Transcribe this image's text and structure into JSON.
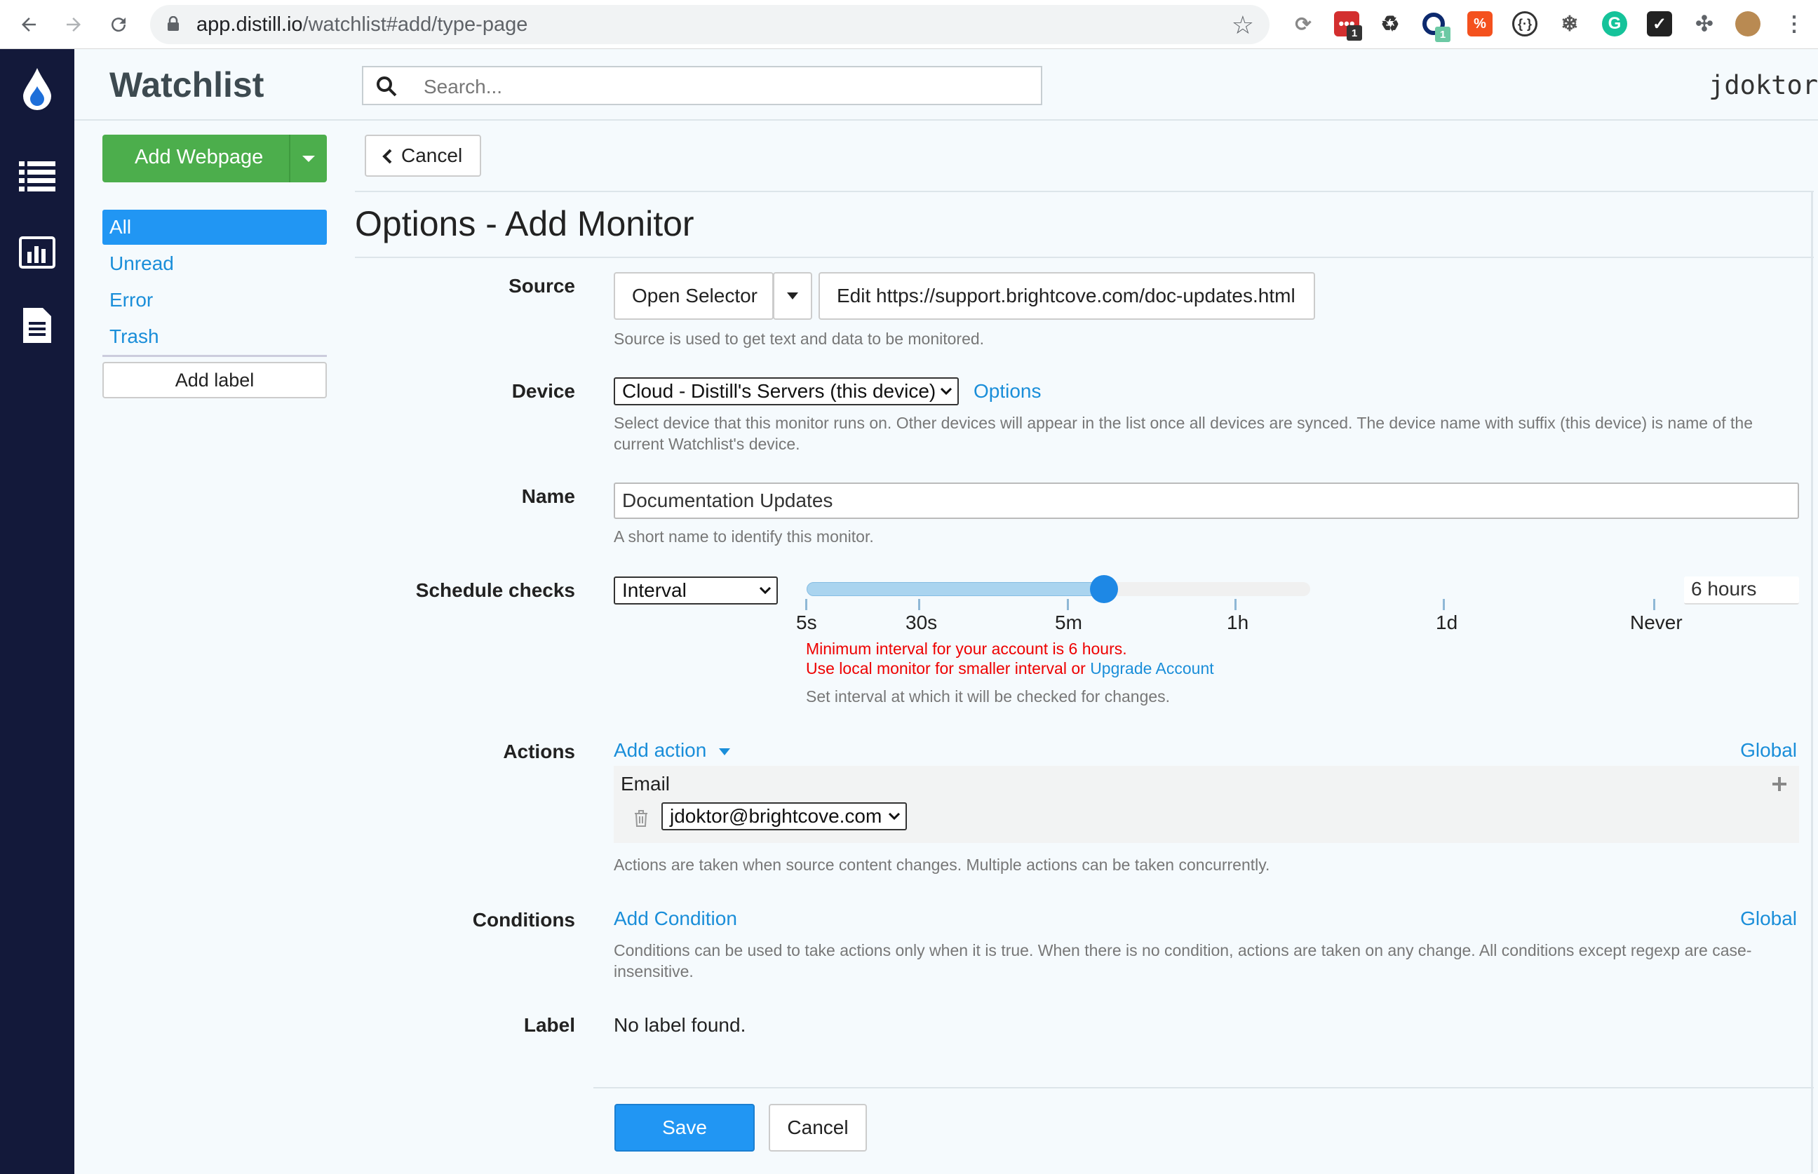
{
  "browser": {
    "url_host": "app.distill.io",
    "url_path": "/watchlist#add/type-page",
    "ext_badge_1": "1",
    "ext_badge_2": "1"
  },
  "header": {
    "brand": "Watchlist",
    "search_placeholder": "Search...",
    "user": "jdoktor"
  },
  "sidebar": {
    "add_button": "Add Webpage",
    "items": [
      {
        "label": "All"
      },
      {
        "label": "Unread"
      },
      {
        "label": "Error"
      },
      {
        "label": "Trash"
      }
    ],
    "add_label": "Add label"
  },
  "page": {
    "cancel_top": "Cancel",
    "title": "Options - Add Monitor"
  },
  "form": {
    "source": {
      "label": "Source",
      "open_selector": "Open Selector",
      "edit_url": "Edit https://support.brightcove.com/doc-updates.html",
      "help": "Source is used to get text and data to be monitored."
    },
    "device": {
      "label": "Device",
      "value": "Cloud - Distill's Servers (this device)",
      "options_link": "Options",
      "help": "Select device that this monitor runs on. Other devices will appear in the list once all devices are synced. The device name with suffix (this device) is name of the current Watchlist's device."
    },
    "name": {
      "label": "Name",
      "value": "Documentation Updates",
      "help": "A short name to identify this monitor."
    },
    "schedule": {
      "label": "Schedule checks",
      "type": "Interval",
      "ticks": [
        "5s",
        "30s",
        "5m",
        "1h",
        "1d",
        "Never"
      ],
      "level_fraction": 0.59,
      "value": "6 hours",
      "err1": "Minimum interval for your account is 6 hours.",
      "err2": "Use local monitor for smaller interval or",
      "upgrade": "Upgrade Account",
      "help": "Set interval at which it will be checked for changes."
    },
    "actions": {
      "label": "Actions",
      "add": "Add action",
      "global": "Global",
      "email_label": "Email",
      "email_value": "jdoktor@brightcove.com",
      "help": "Actions are taken when source content changes. Multiple actions can be taken concurrently."
    },
    "conditions": {
      "label": "Conditions",
      "add": "Add Condition",
      "global": "Global",
      "help": "Conditions can be used to take actions only when it is true. When there is no condition, actions are taken on any change. All conditions except regexp are case-insensitive."
    },
    "label": {
      "label": "Label",
      "value": "No label found."
    },
    "save": "Save",
    "cancel": "Cancel"
  },
  "colors": {
    "accent": "#2196f3",
    "success": "#4cae4c",
    "sidenav": "#13193a",
    "error": "#e00000"
  }
}
